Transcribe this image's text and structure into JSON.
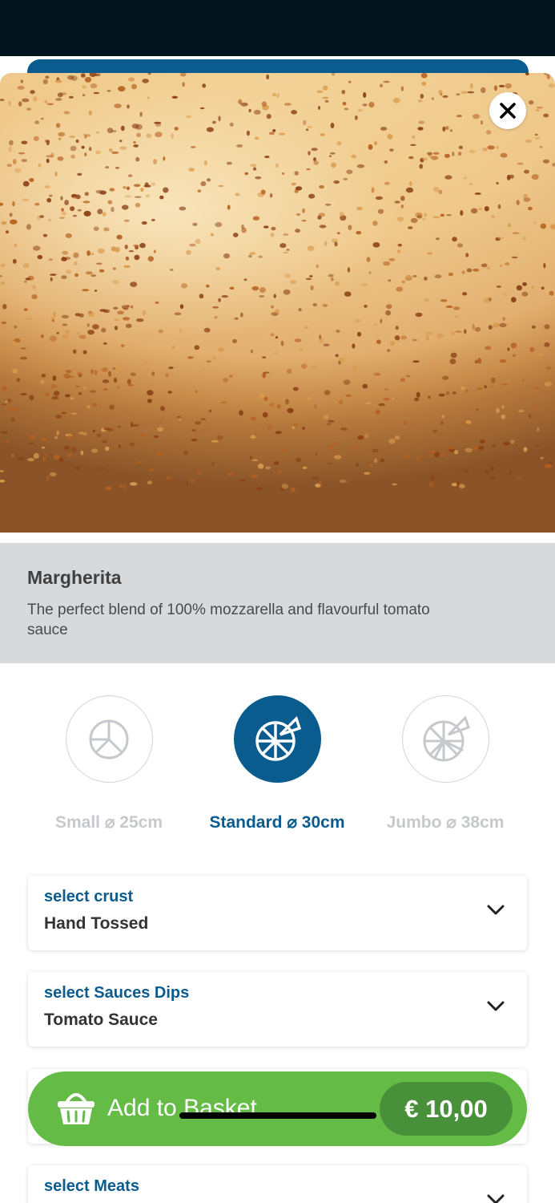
{
  "product": {
    "name": "Margherita",
    "description": "The perfect blend of 100% mozzarella and flavourful tomato sauce"
  },
  "sizes": [
    {
      "label": "Small ⌀ 25cm",
      "selected": false,
      "icon": "pizza-small-icon"
    },
    {
      "label": "Standard ⌀ 30cm",
      "selected": true,
      "icon": "pizza-standard-icon"
    },
    {
      "label": "Jumbo ⌀ 38cm",
      "selected": false,
      "icon": "pizza-jumbo-icon"
    }
  ],
  "options": [
    {
      "label": "select crust",
      "value": "Hand Tossed"
    },
    {
      "label": "select Sauces Dips",
      "value": "Tomato Sauce"
    },
    {
      "label": "",
      "value": ""
    },
    {
      "label": "select Meats",
      "value": ""
    }
  ],
  "basket": {
    "label": "Add to Basket",
    "price": "€ 10,00",
    "icon": "basket-icon"
  },
  "icons": {
    "close": "close-icon",
    "chevron": "chevron-down-icon"
  },
  "colors": {
    "brand_blue": "#0b5c8e",
    "basket_green": "#64bb45",
    "price_pill": "#48903a",
    "info_band": "#d8d9db",
    "status_bar": "#03131e"
  }
}
